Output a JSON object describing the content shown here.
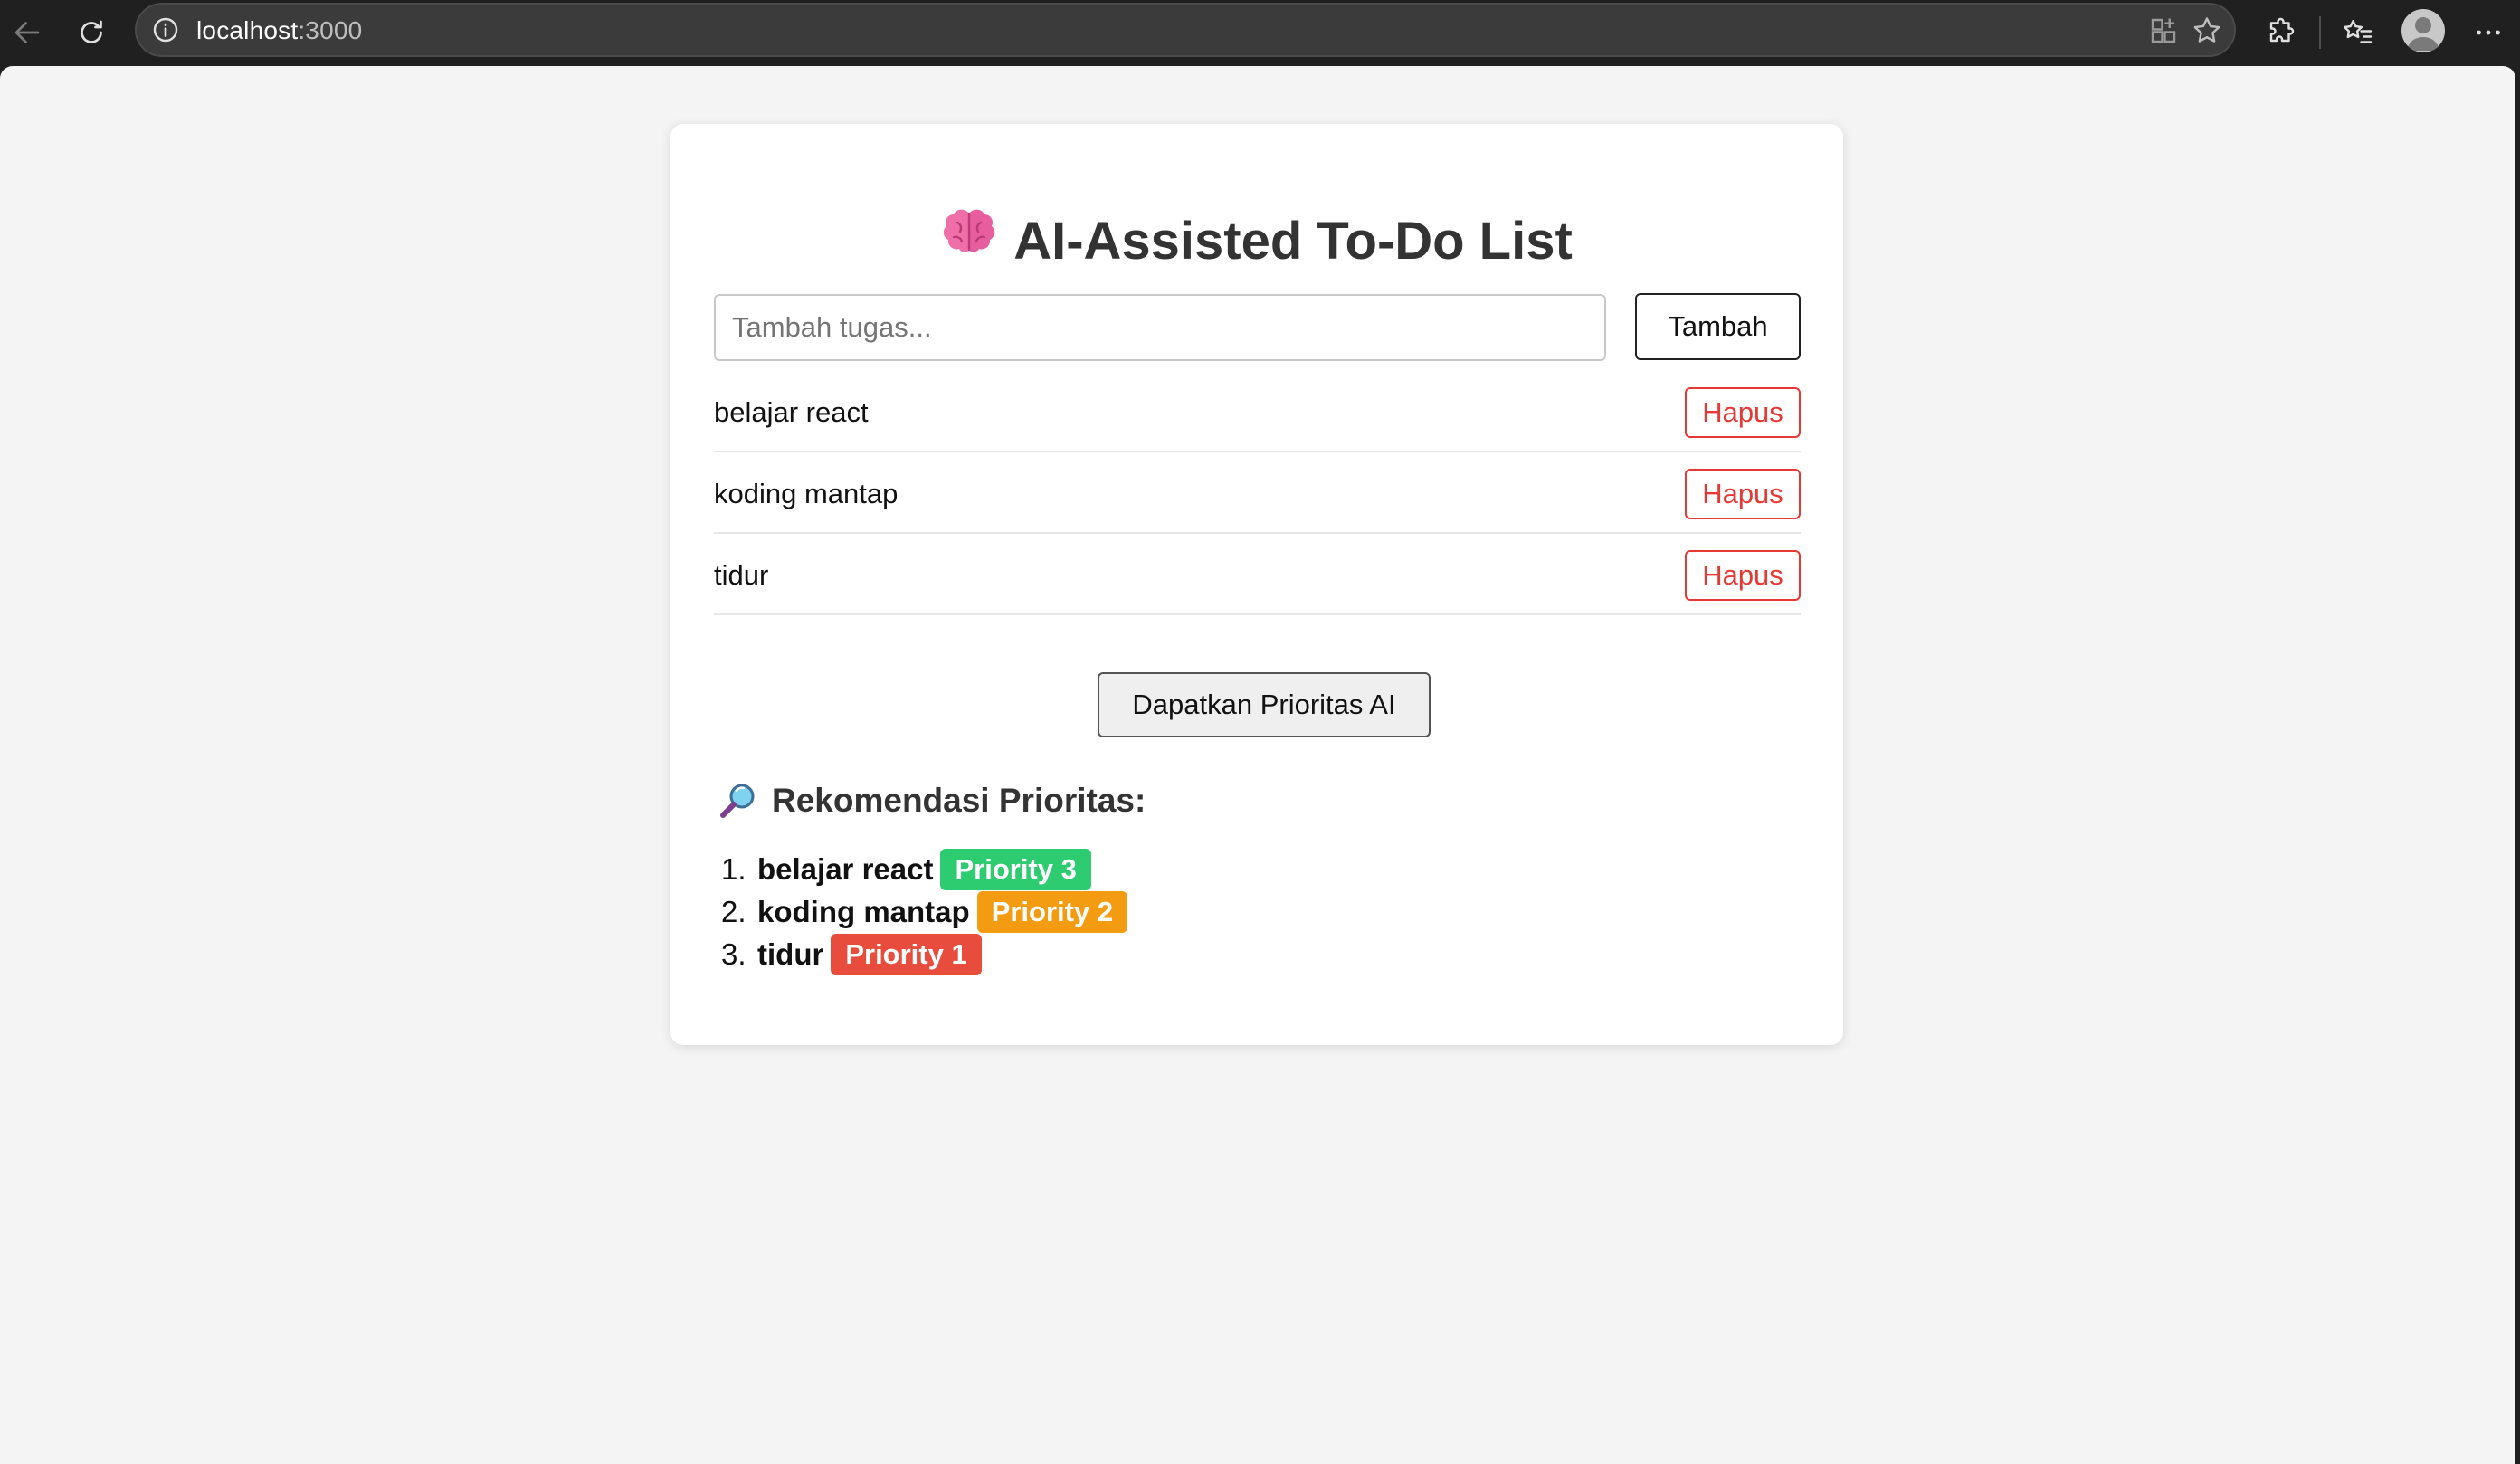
{
  "browser": {
    "url_host": "localhost",
    "url_port": ":3000",
    "icons": [
      "back-icon",
      "reload-icon",
      "site-info-icon",
      "app-install-icon",
      "favorite-star-icon",
      "extensions-icon",
      "favorites-icon",
      "profile-icon",
      "more-icon"
    ]
  },
  "app": {
    "title": "AI-Assisted To-Do List",
    "title_emoji": "🧠",
    "input_placeholder": "Tambah tugas...",
    "input_value": "",
    "add_label": "Tambah",
    "tasks": [
      {
        "text": "belajar react",
        "delete_label": "Hapus"
      },
      {
        "text": "koding mantap",
        "delete_label": "Hapus"
      },
      {
        "text": "tidur",
        "delete_label": "Hapus"
      }
    ],
    "ai_button_label": "Dapatkan Prioritas AI",
    "recommendation_heading": "Rekomendasi Prioritas:",
    "recommendations": [
      {
        "number": "1.",
        "task": "belajar react",
        "badge": "Priority 3",
        "color": "#2ecc71"
      },
      {
        "number": "2.",
        "task": "koding mantap",
        "badge": "Priority 2",
        "color": "#f39c12"
      },
      {
        "number": "3.",
        "task": "tidur",
        "badge": "Priority 1",
        "color": "#e74c3c"
      }
    ]
  },
  "colors": {
    "delete": "#e53935",
    "page_background": "#f4f4f4",
    "chrome": "#202020"
  }
}
